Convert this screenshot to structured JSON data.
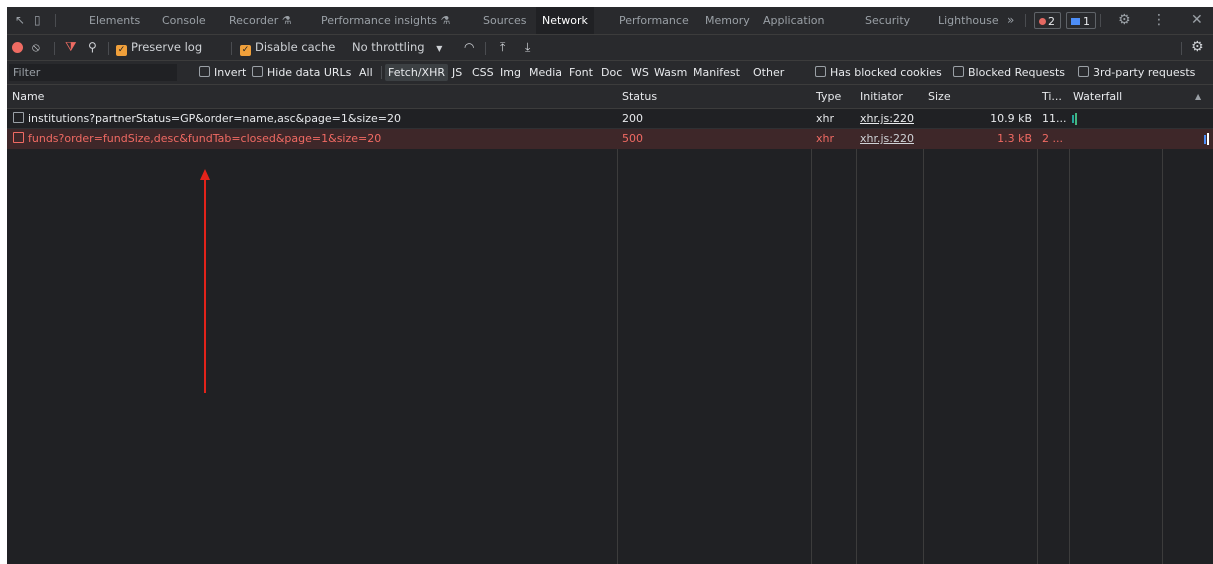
{
  "tabs": [
    "Elements",
    "Console",
    "Recorder",
    "Performance insights",
    "Sources",
    "Network",
    "Performance",
    "Memory",
    "Application",
    "Security",
    "Lighthouse"
  ],
  "tabs_more": "»",
  "badges": {
    "errors": "2",
    "messages": "1"
  },
  "toolbar": {
    "preserve_log": "Preserve log",
    "disable_cache": "Disable cache",
    "throttling": "No throttling"
  },
  "filter": {
    "placeholder": "Filter",
    "invert": "Invert",
    "hide_data_urls": "Hide data URLs",
    "all": "All",
    "types": [
      "Fetch/XHR",
      "JS",
      "CSS",
      "Img",
      "Media",
      "Font",
      "Doc",
      "WS",
      "Wasm",
      "Manifest",
      "Other"
    ],
    "has_blocked_cookies": "Has blocked cookies",
    "blocked_requests": "Blocked Requests",
    "third_party": "3rd-party requests"
  },
  "columns": {
    "name": "Name",
    "status": "Status",
    "type": "Type",
    "initiator": "Initiator",
    "size": "Size",
    "time": "Ti...",
    "waterfall": "Waterfall"
  },
  "rows": [
    {
      "name": "institutions?partnerStatus=GP&order=name,asc&page=1&size=20",
      "status": "200",
      "type": "xhr",
      "initiator": "xhr.js:220",
      "size": "10.9 kB",
      "time": "11..."
    },
    {
      "name": "funds?order=fundSize,desc&fundTab=closed&page=1&size=20",
      "status": "500",
      "type": "xhr",
      "initiator": "xhr.js:220",
      "size": "1.3 kB",
      "time": "2 ..."
    }
  ]
}
